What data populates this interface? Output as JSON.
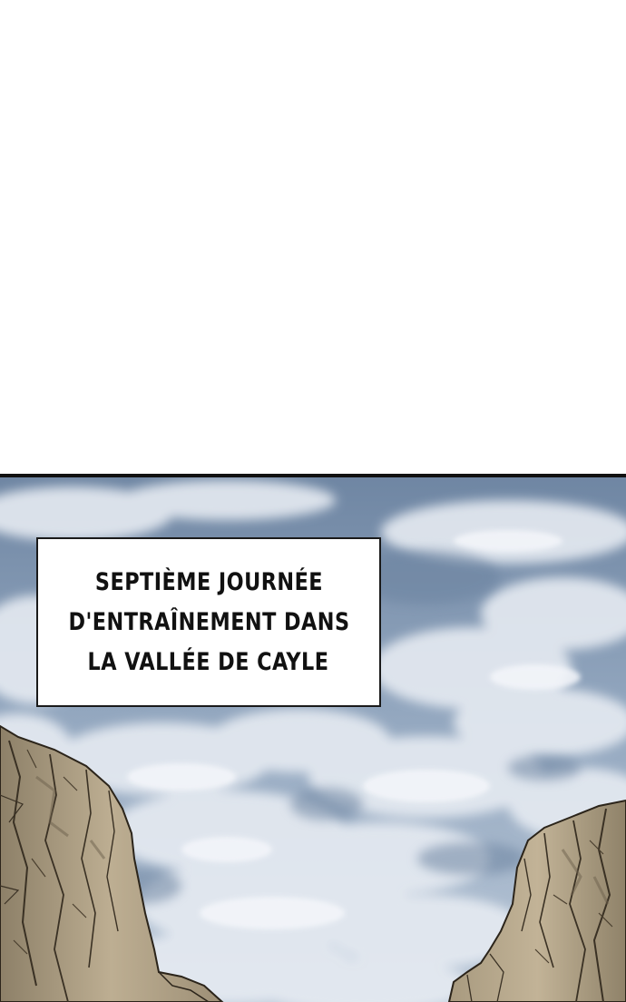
{
  "caption": {
    "lines": [
      "SEPTIÈME JOURNÉE",
      "D'ENTRAÎNEMENT DANS",
      "LA VALLÉE DE CAYLE"
    ]
  },
  "colors": {
    "sky_top": "#7d92ad",
    "sky_mid": "#9eb1c7",
    "cloud": "#e4e9f0",
    "rock_light": "#b3a48a",
    "rock_dark": "#6f6352",
    "panel_border": "#111111"
  }
}
